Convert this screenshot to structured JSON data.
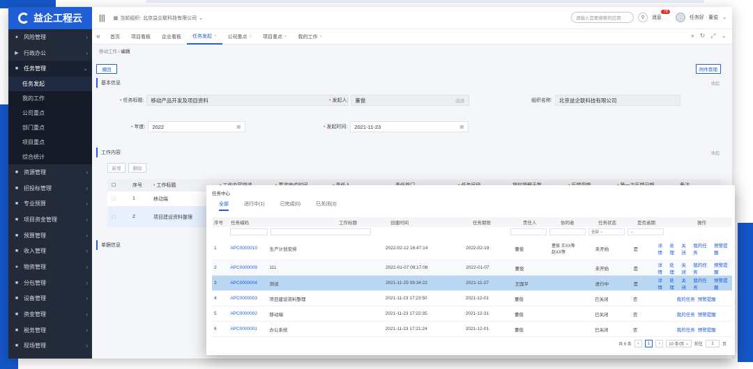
{
  "brand": {
    "name": "益企工程云"
  },
  "sidebar": {
    "items": [
      {
        "icon": "●",
        "label": "风险管理"
      },
      {
        "icon": "▶",
        "label": "行政办公"
      },
      {
        "icon": "■",
        "label": "任务管理"
      },
      {
        "icon": "■",
        "label": "资源管理"
      },
      {
        "icon": "■",
        "label": "招投标管理"
      },
      {
        "icon": "■",
        "label": "专业预算"
      },
      {
        "icon": "■",
        "label": "项目资金管理"
      },
      {
        "icon": "■",
        "label": "预算管理"
      },
      {
        "icon": "■",
        "label": "收入管理"
      },
      {
        "icon": "●",
        "label": "物资管理"
      },
      {
        "icon": "■",
        "label": "分包管理"
      },
      {
        "icon": "■",
        "label": "设备管理"
      },
      {
        "icon": "■",
        "label": "资金管理"
      },
      {
        "icon": "■",
        "label": "税务管理"
      },
      {
        "icon": "■",
        "label": "现场管理"
      }
    ],
    "sub_items": [
      "任务发起",
      "我的工作",
      "公司重点",
      "部门重点",
      "项目重点",
      "综合统计"
    ]
  },
  "topbar": {
    "org_label": "当前组织:",
    "org_name": "北京益企联科技有限公司",
    "search_placeholder": "请输入您要搜索的应用",
    "message_label": "消息",
    "message_count": "79",
    "user_label": "任务好 · 董俊"
  },
  "tabs": [
    "首页",
    "项目看板",
    "企业看板",
    "任务发起",
    "公司重点",
    "项目重点",
    "我的工作"
  ],
  "breadcrumb": {
    "parent": "移动工作",
    "current": "编辑"
  },
  "buttons": {
    "return": "撤回",
    "attachments": "附件管理",
    "add": "新增",
    "delete": "删除"
  },
  "basic_info": {
    "title": "基本信息",
    "fold": "收起",
    "task_title_label": "任务标题:",
    "task_title_value": "移动产品开发及项目资料",
    "initiator_label": "发起人:",
    "initiator_value": "董俊",
    "initiator_select": "选择",
    "org_label": "组织名称:",
    "org_value": "北京益企联科技有限公司",
    "year_label": "年度:",
    "year_value": "2022",
    "time_label": "发起时间:",
    "time_value": "2021-11-23"
  },
  "work_content": {
    "title": "工作内容",
    "fold": "收起",
    "columns": [
      "序号",
      "工作标题",
      "工作内容描述",
      "要求完成时间",
      "责任人",
      "责任部门",
      "任务层级",
      "提前提醒天数",
      "反馈周期",
      "第一次反馈日期",
      "备注"
    ],
    "rows": [
      {
        "no": "1",
        "title": "移动端"
      },
      {
        "no": "2",
        "title": "项目建设资料整理"
      }
    ]
  },
  "attach_section": {
    "title": "单据信息"
  },
  "task_center": {
    "title": "任务中心",
    "tabs": [
      "全部",
      "进行中(1)",
      "已完成(0)",
      "已关闭(3)"
    ],
    "columns": [
      "序号",
      "任务编码",
      "工作标题",
      "创建时间",
      "任务期限",
      "责任人",
      "协同者",
      "任务状态",
      "是否逾期",
      "操作"
    ],
    "filter_all": "全部",
    "rows": [
      {
        "no": "1",
        "code": "APC0000010",
        "title": "生产计划安排",
        "created": "2022-02-12 16:47:14",
        "deadline": "2022-02-19",
        "owner": "董俊",
        "assist": "董俊 王XX等 赵XX等",
        "status": "未开始",
        "overdue": "是",
        "ops": [
          "详情",
          "处理",
          "关闭",
          "我的任务",
          "预警提醒"
        ]
      },
      {
        "no": "2",
        "code": "APC0000009",
        "title": "111",
        "created": "2022-01-07 09:17:08",
        "deadline": "2022-01-07",
        "owner": "董俊",
        "assist": "",
        "status": "未开始",
        "overdue": "是",
        "ops": [
          "详情",
          "处理",
          "关闭",
          "我的任务",
          "预警提醒"
        ]
      },
      {
        "no": "3",
        "code": "APC0000004",
        "title": "测试",
        "created": "2021-11-25 09:34:22",
        "deadline": "2021-11-27",
        "owner": "王国平",
        "assist": "",
        "status": "进行中",
        "overdue": "是",
        "ops": [
          "详情",
          "处理",
          "关闭",
          "我的任务",
          "预警提醒"
        ]
      },
      {
        "no": "4",
        "code": "APC0000003",
        "title": "项目建设资料整理",
        "created": "2021-11-23 17:23:50",
        "deadline": "2021-12-01",
        "owner": "董俊",
        "assist": "",
        "status": "已关闭",
        "overdue": "否",
        "ops": [
          "我的任务",
          "预警提醒"
        ]
      },
      {
        "no": "5",
        "code": "APC0000002",
        "title": "移动端",
        "created": "2021-11-23 17:22:35",
        "deadline": "2021-12-31",
        "owner": "董俊",
        "assist": "",
        "status": "已关闭",
        "overdue": "否",
        "ops": [
          "我的任务",
          "预警提醒"
        ]
      },
      {
        "no": "6",
        "code": "APC0000001",
        "title": "办公系统",
        "created": "2021-11-23 17:21:24",
        "deadline": "2021-12-01",
        "owner": "董俊",
        "assist": "",
        "status": "已关闭",
        "overdue": "否",
        "ops": [
          "我的任务",
          "预警提醒"
        ]
      }
    ],
    "pager": {
      "total": "共 6 条",
      "current": "1",
      "page_size": "10 条/页",
      "goto_label": "前往",
      "goto_value": "1",
      "page_unit": "页"
    }
  },
  "colors": {
    "accent": "#1f5fd6",
    "sidebar": "#232b3a",
    "deco": "#1557c8"
  },
  "icons": {
    "search": "search-icon",
    "menu": "hamburger-icon",
    "refresh": "refresh-icon",
    "expand": "expand-icon",
    "calendar": "calendar-icon"
  }
}
